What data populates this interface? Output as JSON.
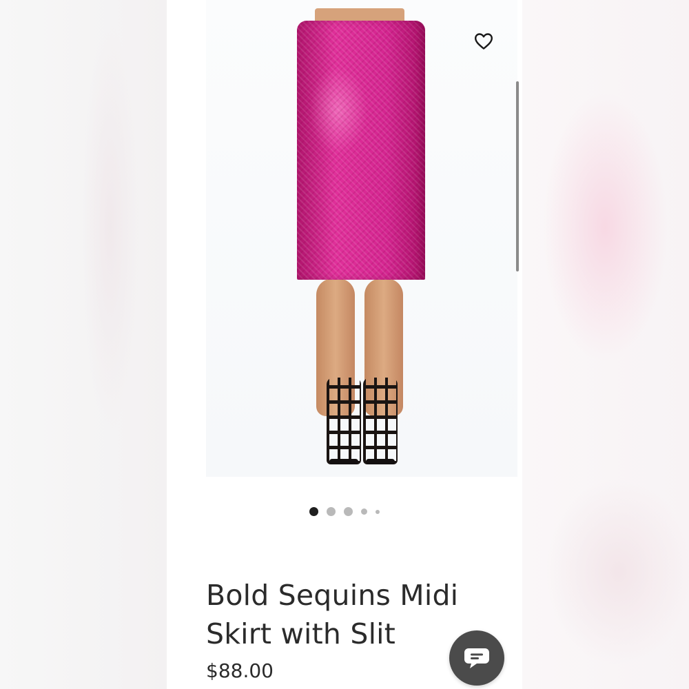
{
  "product": {
    "title": "Bold Sequins Midi Skirt with Slit",
    "price": "$88.00",
    "image_alt": "pink sequin midi skirt",
    "image_count": 5,
    "active_image_index": 1
  },
  "icons": {
    "favorite": "heart-outline-icon",
    "chat": "chat-bubble-icon"
  },
  "colors": {
    "skirt": "#d42590",
    "text": "#2b2b2b",
    "chat_button": "#4b4b4b",
    "dot_active": "#1f1f1f",
    "dot_inactive": "#b9b9b9"
  }
}
